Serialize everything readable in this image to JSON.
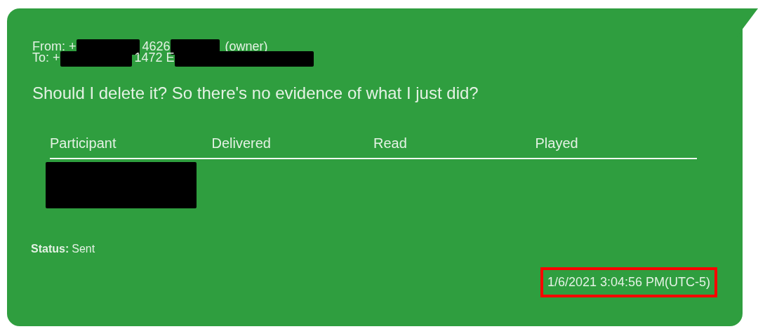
{
  "message": {
    "from": {
      "prefix": "From: +",
      "redacted_after_prefix": true,
      "number_tail": "4626",
      "redacted_after_number": true,
      "role": "(owner)"
    },
    "to": {
      "prefix": "To: +",
      "redacted_after_prefix": true,
      "number_tail": "1472 E",
      "redacted_after_number": true
    },
    "body": "Should I delete it? So there's no evidence of what I just did?",
    "participants_table": {
      "columns": [
        "Participant",
        "Delivered",
        "Read",
        "Played"
      ],
      "rows": [
        {
          "participant_redacted": true
        }
      ]
    },
    "status_label": "Status:",
    "status": "Sent",
    "timestamp": {
      "text": "1/6/2021 3:04:56 PM(UTC-5)",
      "highlighted": true
    }
  }
}
